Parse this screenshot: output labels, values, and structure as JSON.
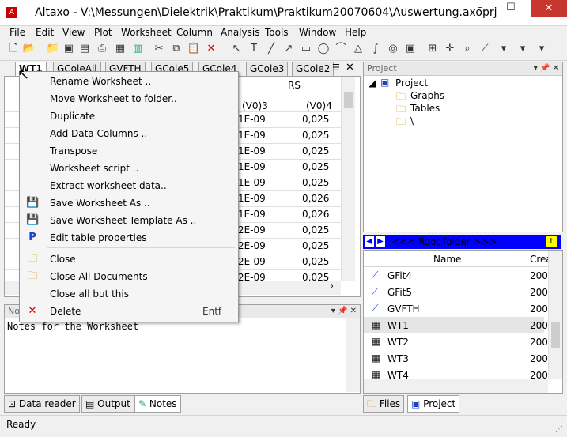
{
  "window": {
    "title": "Altaxo - V:\\Messungen\\Dielektrik\\Praktikum\\Praktikum20070604\\Auswertung.axoprj",
    "app_icon": "altaxo-icon",
    "minimize": "–",
    "maximize": "☐",
    "close": "✕"
  },
  "menubar": [
    "File",
    "Edit",
    "View",
    "Plot",
    "Worksheet",
    "Column",
    "Analysis",
    "Tools",
    "Window",
    "Help"
  ],
  "worksheet_tabs": [
    "WT1",
    "GColeAll",
    "GVFTH",
    "GCole5",
    "GCole4",
    "GCole3",
    "GCole2"
  ],
  "worksheet_grid": {
    "header_top": "RS",
    "column_headers": [
      "(V0)3",
      "(V0)4"
    ],
    "col3": [
      "1E-09",
      "1E-09",
      "1E-09",
      "1E-09",
      "1E-09",
      "1E-09",
      "1E-09",
      "2E-09",
      "2E-09",
      "2E-09",
      "2E-09"
    ],
    "col4": [
      "0,025",
      "0,025",
      "0,025",
      "0,025",
      "0,025",
      "0,026",
      "0,026",
      "0,025",
      "0,025",
      "0,025",
      "0,025"
    ]
  },
  "context_menu": {
    "items": [
      {
        "label": "Rename Worksheet ..",
        "icon": ""
      },
      {
        "label": "Move Worksheet to folder..",
        "icon": ""
      },
      {
        "label": "Duplicate",
        "icon": ""
      },
      {
        "label": "Add Data Columns ..",
        "icon": ""
      },
      {
        "label": "Transpose",
        "icon": ""
      },
      {
        "label": "Worksheet script ..",
        "icon": ""
      },
      {
        "label": "Extract worksheet data..",
        "icon": ""
      },
      {
        "label": "Save Worksheet As ..",
        "icon": "save-icon"
      },
      {
        "label": "Save Worksheet Template As ..",
        "icon": "save-icon"
      },
      {
        "label": "Edit table properties",
        "icon": "properties-icon"
      },
      {
        "label": "Close",
        "icon": "folder-icon"
      },
      {
        "label": "Close All Documents",
        "icon": "folders-icon"
      },
      {
        "label": "Close all but this",
        "icon": ""
      },
      {
        "label": "Delete",
        "icon": "delete-icon",
        "shortcut": "Entf"
      }
    ]
  },
  "notes": {
    "title": "No",
    "text": "Notes for the Worksheet"
  },
  "bottom_tabs": [
    "Data reader",
    "Output",
    "Notes"
  ],
  "project": {
    "title": "Project",
    "tree": [
      "Project",
      "Graphs",
      "Tables",
      "\\"
    ],
    "root_folder_label": "<<< Root folder >>>",
    "list_headers": [
      "Name",
      "Crea"
    ],
    "list_items": [
      {
        "name": "GFit4",
        "date": "200"
      },
      {
        "name": "GFit5",
        "date": "200"
      },
      {
        "name": "GVFTH",
        "date": "200"
      },
      {
        "name": "WT1",
        "date": "200"
      },
      {
        "name": "WT2",
        "date": "200"
      },
      {
        "name": "WT3",
        "date": "200"
      },
      {
        "name": "WT4",
        "date": "200"
      }
    ],
    "tabs": [
      "Files",
      "Project"
    ]
  },
  "status": {
    "text": "Ready"
  },
  "colors": {
    "accent": "#0000ff",
    "close": "#c7372f",
    "delete": "#cc0000"
  }
}
